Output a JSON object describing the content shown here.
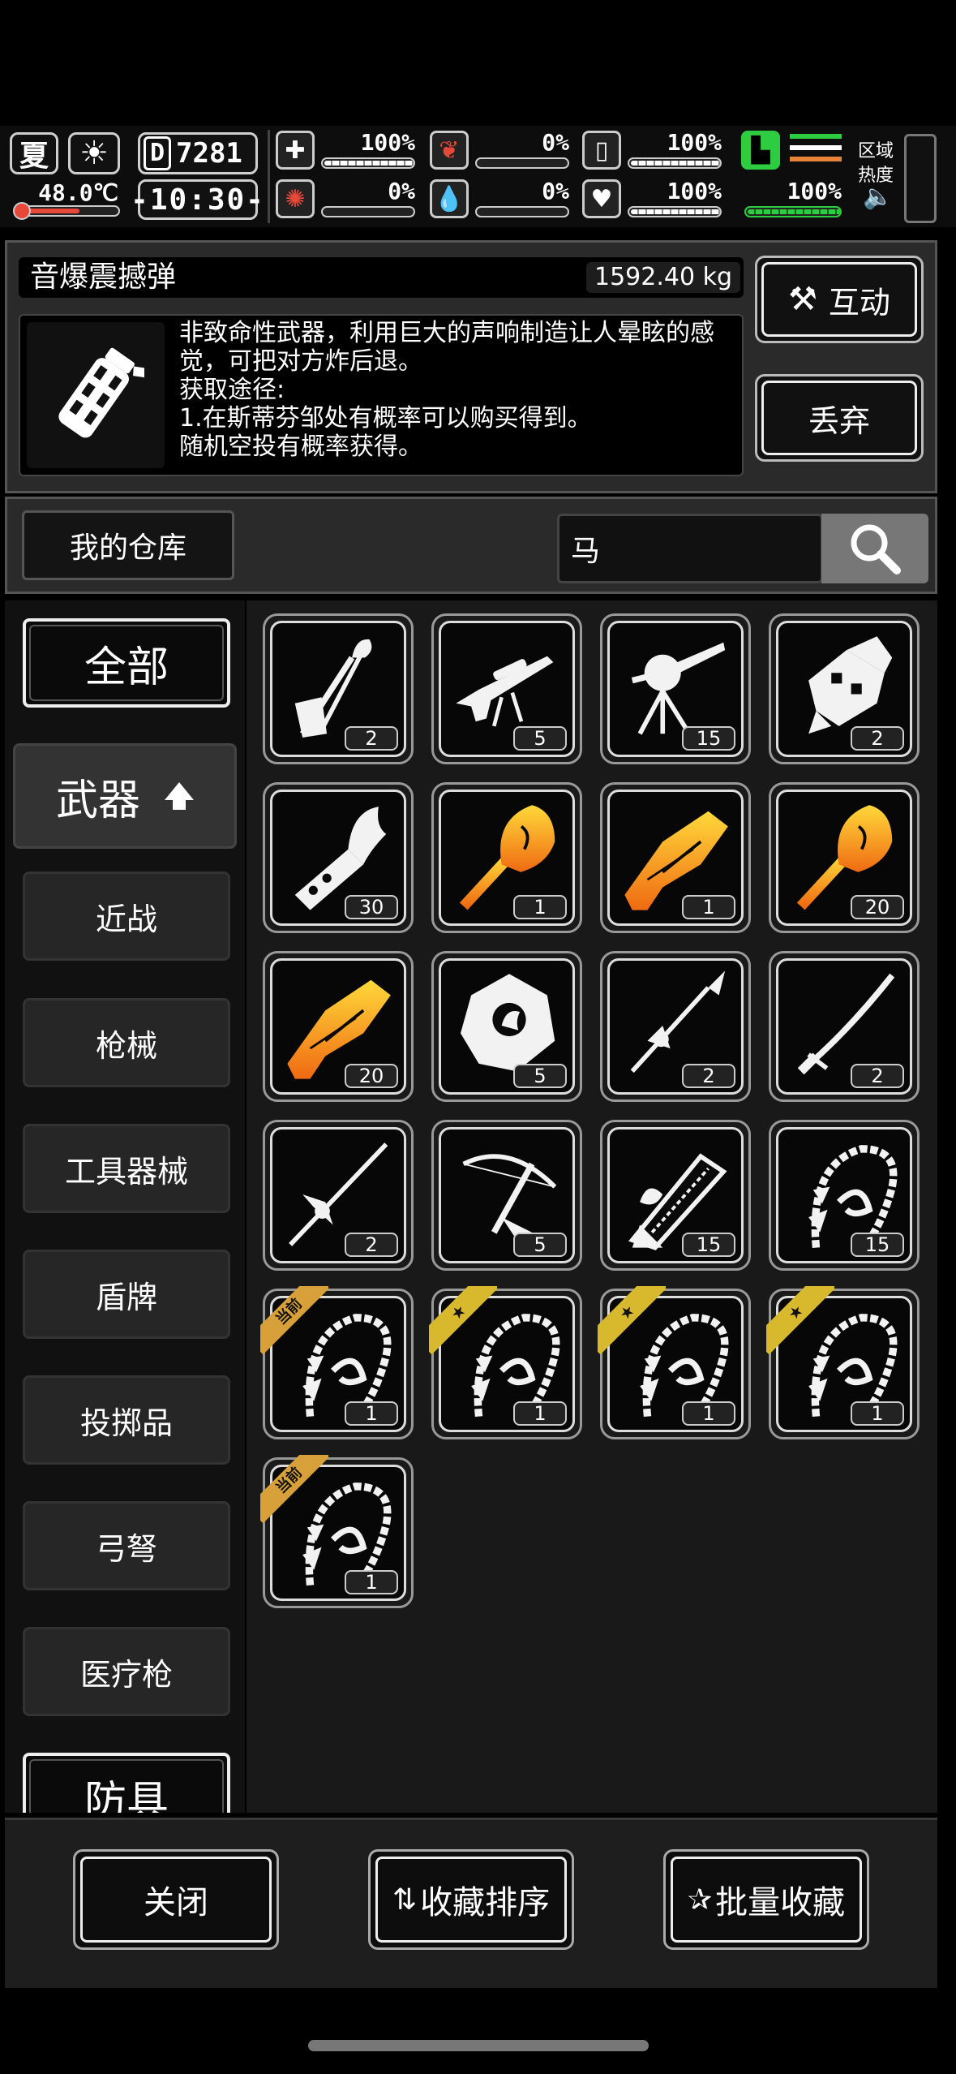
{
  "status": {
    "season": "夏",
    "temperature": "48.0℃",
    "day_count": "7281",
    "day_label": "D",
    "clock": "-10:30-",
    "stats": [
      {
        "name": "health",
        "icon": "medkit-icon",
        "value": "100%",
        "fill": 1.0
      },
      {
        "name": "hunger",
        "icon": "stomach-icon",
        "value": "0%",
        "fill": 0.0
      },
      {
        "name": "thirst",
        "icon": "bottle-icon",
        "value": "100%",
        "fill": 1.0
      },
      {
        "name": "sanity",
        "icon": "brain-icon",
        "value": "0%",
        "fill": 0.0
      },
      {
        "name": "blood",
        "icon": "blood-drop-icon",
        "value": "0%",
        "fill": 0.0
      },
      {
        "name": "mood",
        "icon": "heart-icon",
        "value": "100%",
        "fill": 1.0
      }
    ],
    "stamina": {
      "value": "100%",
      "fill": 1.0
    },
    "region_label": "区域\n热度",
    "accent_green": "#2ecc40",
    "accent_orange": "#e8833a",
    "accent_red": "#e8483a"
  },
  "item": {
    "name": "音爆震撼弹",
    "weight": "1592.40 kg",
    "description": [
      "非致命性武器，利用巨大的声响制造让人晕眩的感觉，可把对方炸后退。",
      "获取途径:",
      "1.在斯蒂芬邹处有概率可以购买得到。",
      "随机空投有概率获得。"
    ],
    "image_icon": "grenade-icon"
  },
  "actions": {
    "interact": "互动",
    "discard": "丢弃"
  },
  "search": {
    "warehouse_label": "我的仓库",
    "query": "马"
  },
  "categories": {
    "all": "全部",
    "weapons": "武器",
    "items": [
      "近战",
      "枪械",
      "工具器械",
      "盾牌",
      "投掷品",
      "弓弩",
      "医疗枪"
    ],
    "armor": "防具"
  },
  "grid": [
    {
      "icon": "horse-axe-icon",
      "count": "2"
    },
    {
      "icon": "sniper-rifle-icon",
      "count": "5"
    },
    {
      "icon": "mounted-gun-icon",
      "count": "15"
    },
    {
      "icon": "gauntlet-icon",
      "count": "2"
    },
    {
      "icon": "horse-cannon-icon",
      "count": "30"
    },
    {
      "icon": "golden-horse-mace-icon",
      "count": "1"
    },
    {
      "icon": "golden-horse-gun-icon",
      "count": "1"
    },
    {
      "icon": "golden-horse-mace-icon",
      "count": "20"
    },
    {
      "icon": "golden-horse-gun-icon",
      "count": "20"
    },
    {
      "icon": "horse-shield-icon",
      "count": "5"
    },
    {
      "icon": "spear-icon",
      "count": "2"
    },
    {
      "icon": "katana-icon",
      "count": "2"
    },
    {
      "icon": "lance-icon",
      "count": "2"
    },
    {
      "icon": "crossbow-icon",
      "count": "5"
    },
    {
      "icon": "chainsaw-icon",
      "count": "15"
    },
    {
      "icon": "bone-whip-icon",
      "count": "15"
    },
    {
      "icon": "bone-whip-icon",
      "count": "1",
      "tag": "当前"
    },
    {
      "icon": "bone-whip-icon",
      "count": "1",
      "tag": "★"
    },
    {
      "icon": "bone-whip-icon",
      "count": "1",
      "tag": "★"
    },
    {
      "icon": "bone-whip-icon",
      "count": "1",
      "tag": "★"
    },
    {
      "icon": "bone-whip-icon",
      "count": "1",
      "tag": "当前"
    }
  ],
  "bottom": {
    "close": "关闭",
    "sort": "收藏排序",
    "batch": "批量收藏"
  }
}
